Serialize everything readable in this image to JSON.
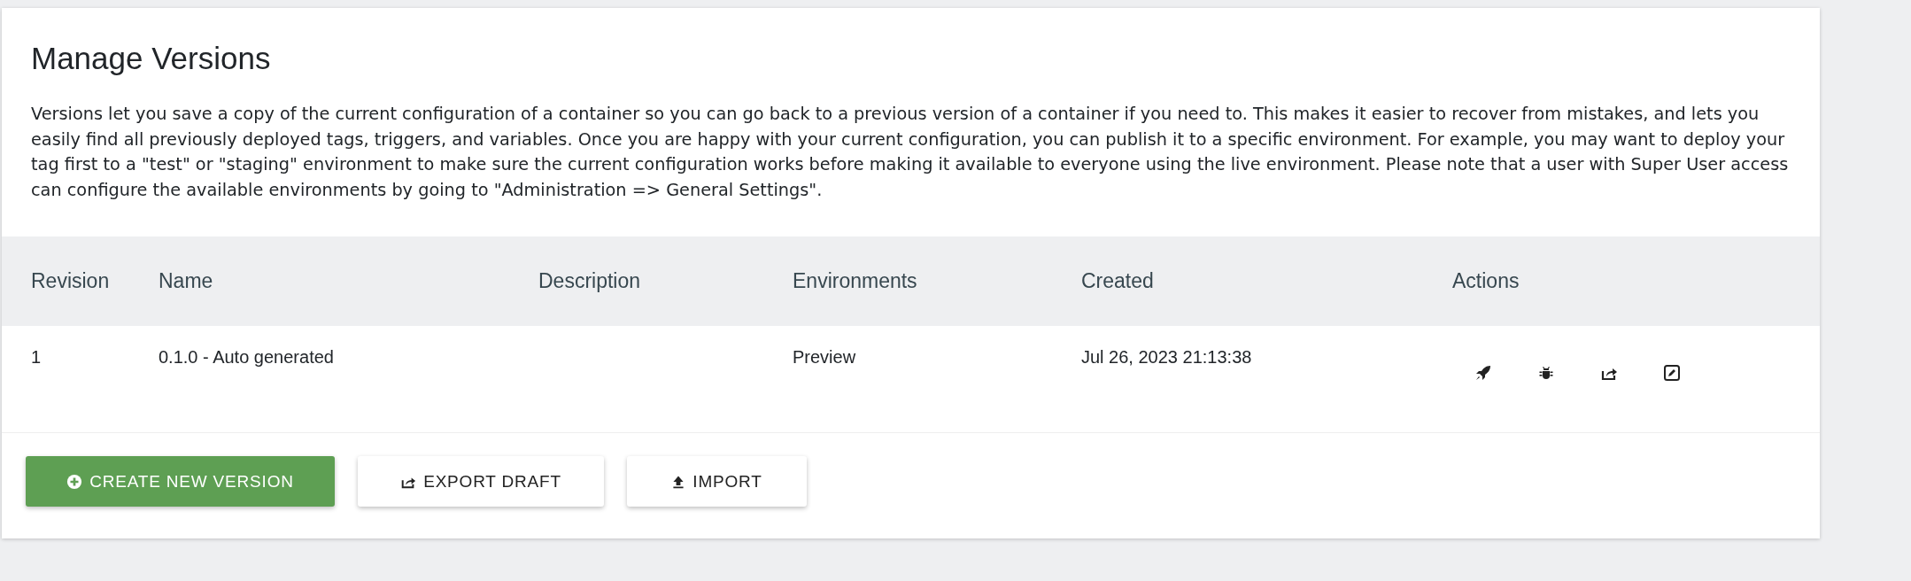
{
  "title": "Manage Versions",
  "description": "Versions let you save a copy of the current configuration of a container so you can go back to a previous version of a container if you need to. This makes it easier to recover from mistakes, and lets you easily find all previously deployed tags, triggers, and variables. Once you are happy with your current configuration, you can publish it to a specific environment. For example, you may want to deploy your tag first to a \"test\" or \"staging\" environment to make sure the current configuration works before making it available to everyone using the live environment. Please note that a user with Super User access can configure the available environments by going to \"Administration => General Settings\".",
  "table": {
    "columns": [
      "Revision",
      "Name",
      "Description",
      "Environments",
      "Created",
      "Actions"
    ],
    "rows": [
      {
        "revision": "1",
        "name": "0.1.0 - Auto generated",
        "environments": "Preview",
        "created": "Jul 26, 2023 21:13:38",
        "actions": [
          {
            "kind": "publish"
          },
          {
            "kind": "debug"
          },
          {
            "kind": "export"
          },
          {
            "kind": "edit"
          }
        ]
      }
    ]
  },
  "buttons": [
    {
      "label": "CREATE NEW VERSION",
      "kind": "create"
    },
    {
      "label": "EXPORT DRAFT",
      "kind": "export"
    },
    {
      "label": "IMPORT",
      "kind": "import"
    }
  ]
}
